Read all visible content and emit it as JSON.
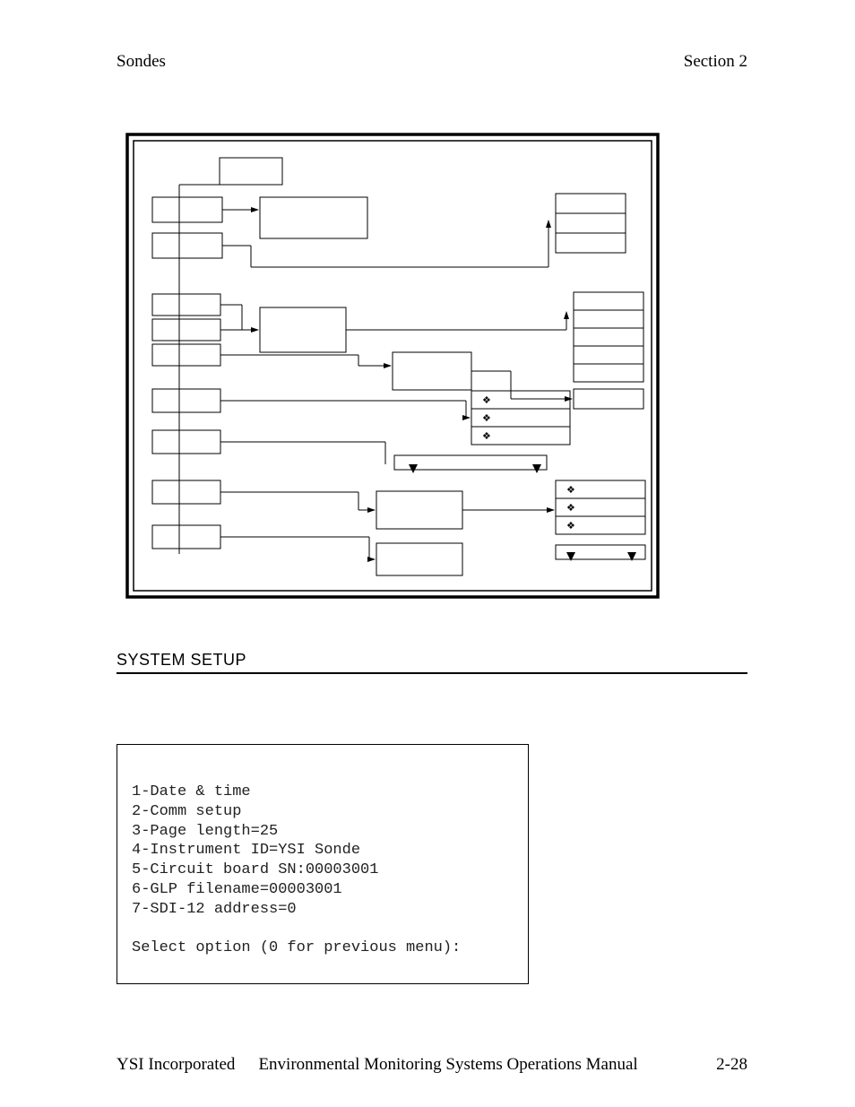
{
  "header": {
    "left": "Sondes",
    "right": "Section 2"
  },
  "section_title": "SYSTEM SETUP",
  "menu": {
    "lines": [
      "1-Date & time",
      "2-Comm setup",
      "3-Page length=25",
      "4-Instrument ID=YSI Sonde",
      "5-Circuit board SN:00003001",
      "6-GLP filename=00003001",
      "7-SDI-12 address=0"
    ],
    "prompt": "Select option (0 for previous menu):"
  },
  "footer": {
    "company": "YSI Incorporated",
    "manual": "Environmental Monitoring Systems Operations Manual",
    "page": "2-28"
  }
}
